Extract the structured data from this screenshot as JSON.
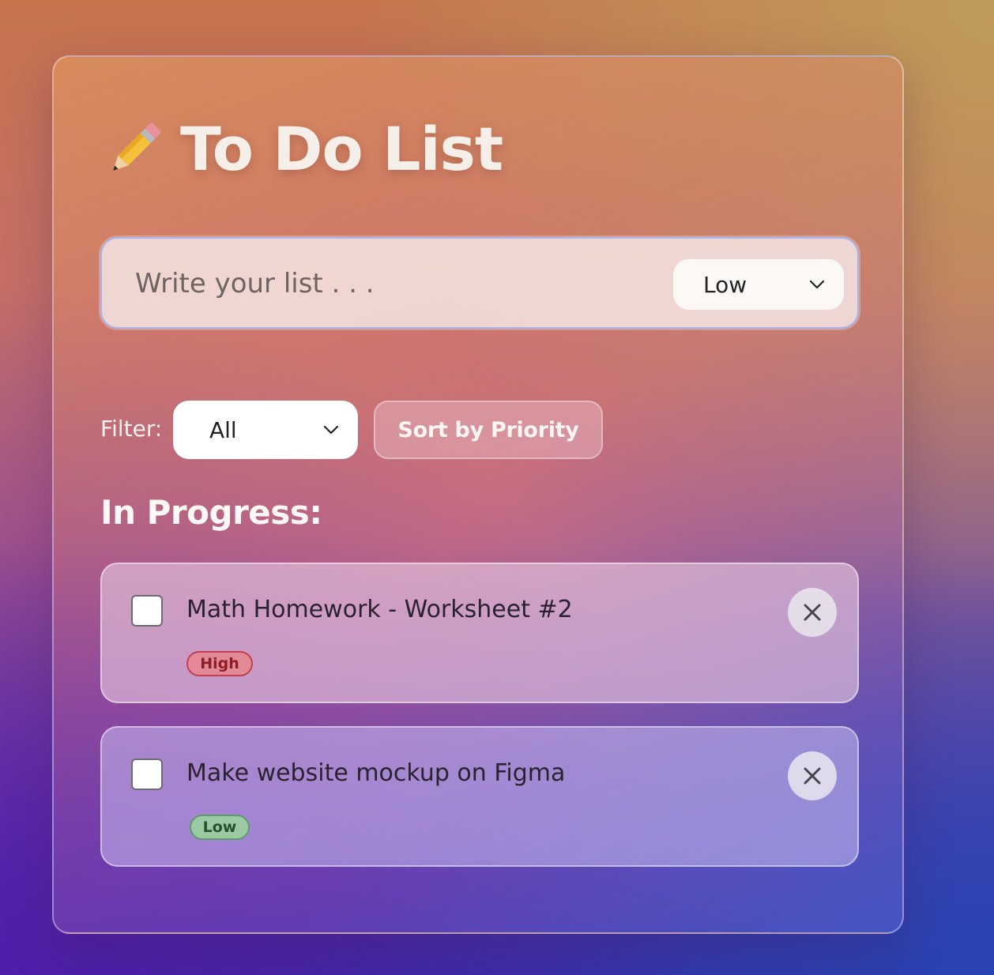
{
  "header": {
    "icon": "pencil-icon",
    "title": "To Do List"
  },
  "new_task": {
    "placeholder": "Write your list . . .",
    "value": "",
    "priority_selected": "Low"
  },
  "controls": {
    "filter_label": "Filter:",
    "filter_selected": "All",
    "sort_label": "Sort by Priority"
  },
  "section": {
    "title": "In Progress:"
  },
  "tasks": [
    {
      "text": "Math Homework - Worksheet #2",
      "priority": "High",
      "checked": false,
      "delete_icon": "close-icon"
    },
    {
      "text": "Make website mockup on Figma",
      "priority": "Low",
      "checked": false,
      "delete_icon": "close-icon"
    }
  ],
  "colors": {
    "high_badge_bg": "#e28a97",
    "high_badge_text": "#8e1d24",
    "low_badge_bg": "#9ac9a3",
    "low_badge_text": "#23522d",
    "input_focus_border": "#a7b3f2"
  }
}
